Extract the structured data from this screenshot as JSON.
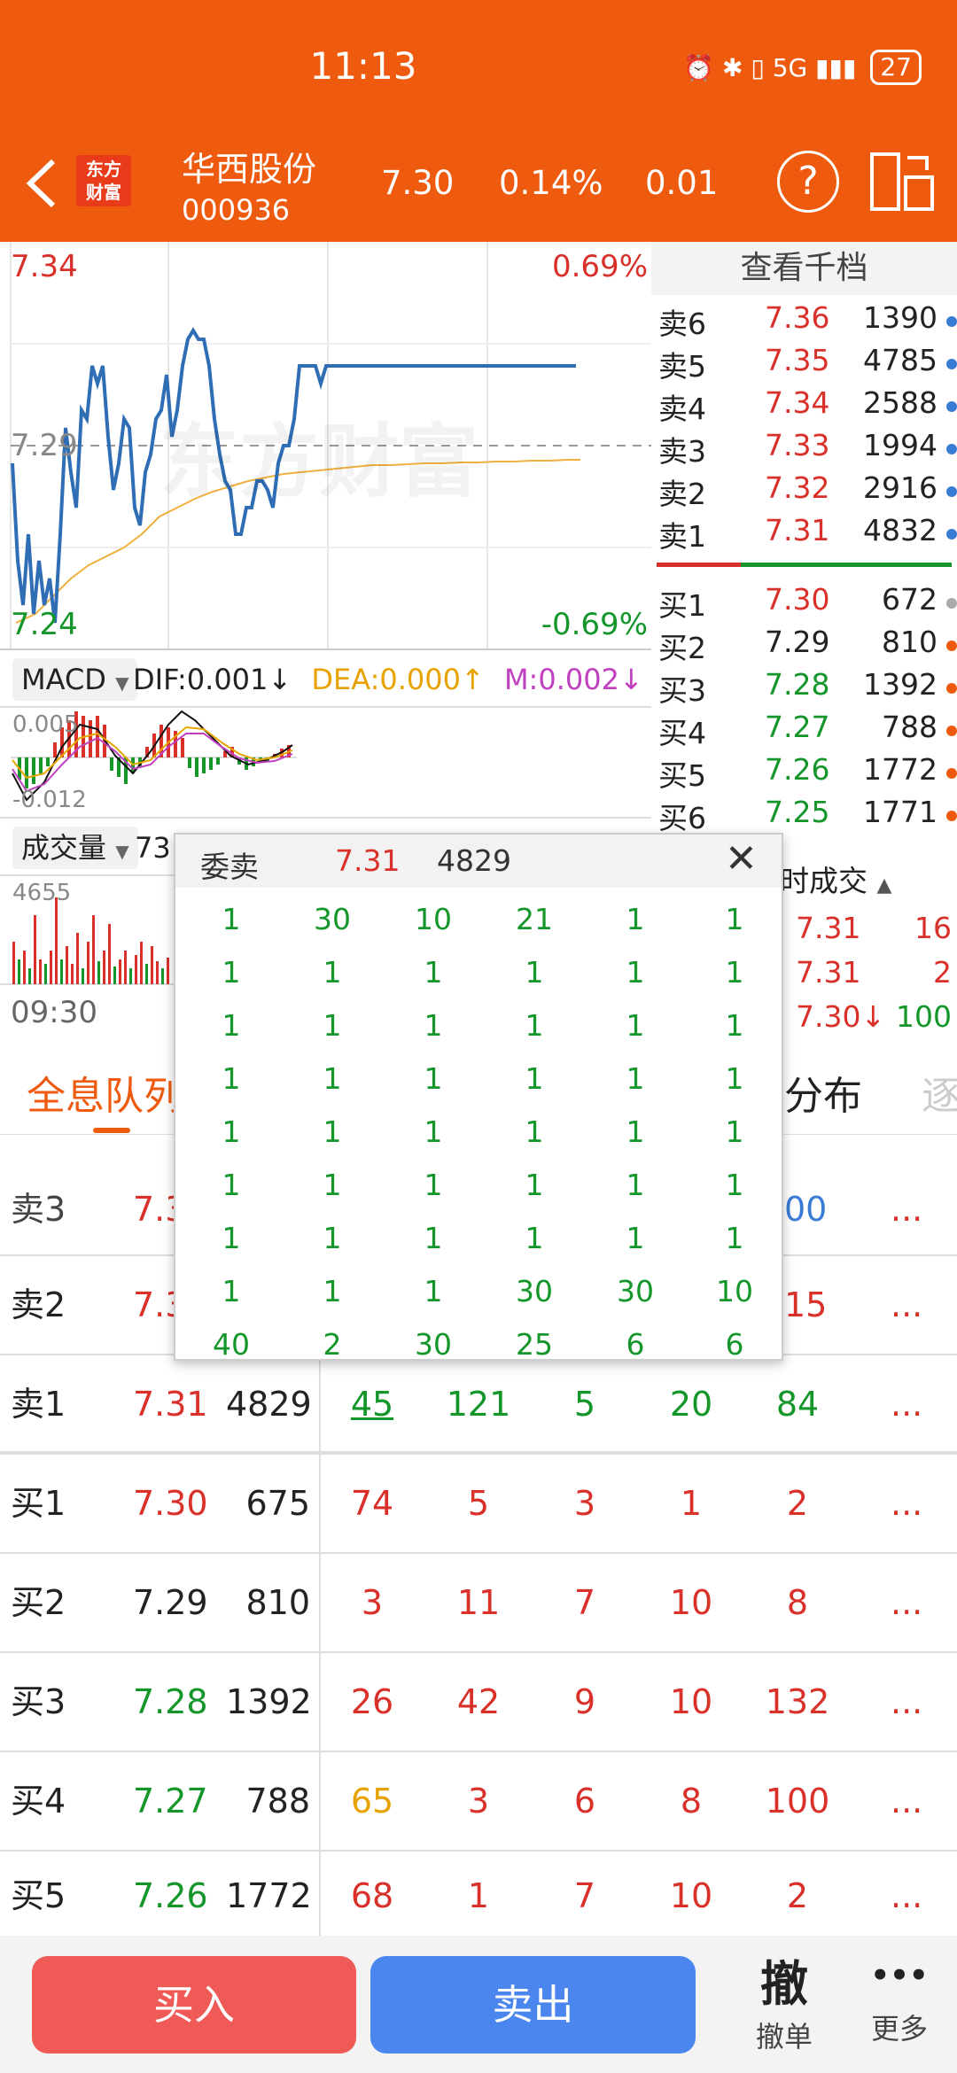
{
  "status_bar": {
    "time": "11:13",
    "icons": "⏰ ✱ ▯ 5G ▮▮▮",
    "battery": "27"
  },
  "header": {
    "logo": [
      "东方",
      "财富"
    ],
    "name": "华西股份",
    "code": "000936",
    "price": "7.30",
    "pct": "0.14%",
    "change": "0.01"
  },
  "chart": {
    "top_price": "7.34",
    "top_pct": "0.69%",
    "mid_price": "7.29",
    "bottom_price": "7.24",
    "bottom_pct": "-0.69%",
    "watermark": "东方财富",
    "macd_select": "MACD",
    "dif": "DIF:0.001",
    "dif_arrow": "↓",
    "dea": "DEA:0.000",
    "dea_arrow": "↑",
    "m": "M:0.002",
    "m_arrow": "↓",
    "macd_top": "0.005",
    "macd_bottom": "-0.012",
    "vol_select": "成交量",
    "vol_value": "73",
    "vol_max": "4655",
    "time_start": "09:30"
  },
  "depth": {
    "title": "查看千档",
    "asks": [
      {
        "label": "卖6",
        "price": "7.36",
        "vol": "1390"
      },
      {
        "label": "卖5",
        "price": "7.35",
        "vol": "4785"
      },
      {
        "label": "卖4",
        "price": "7.34",
        "vol": "2588"
      },
      {
        "label": "卖3",
        "price": "7.33",
        "vol": "1994"
      },
      {
        "label": "卖2",
        "price": "7.32",
        "vol": "2916"
      },
      {
        "label": "卖1",
        "price": "7.31",
        "vol": "4832"
      }
    ],
    "bids": [
      {
        "label": "买1",
        "price": "7.30",
        "vol": "672"
      },
      {
        "label": "买2",
        "price": "7.29",
        "vol": "810"
      },
      {
        "label": "买3",
        "price": "7.28",
        "vol": "1392"
      },
      {
        "label": "买4",
        "price": "7.27",
        "vol": "788"
      },
      {
        "label": "买5",
        "price": "7.26",
        "vol": "1772"
      },
      {
        "label": "买6",
        "price": "7.25",
        "vol": "1771"
      }
    ]
  },
  "trades": {
    "title": "时成交",
    "rows": [
      {
        "price": "7.31",
        "vol": "16"
      },
      {
        "price": "7.31",
        "vol": "2"
      },
      {
        "price": "7.30↓",
        "vol": "100"
      }
    ]
  },
  "tabs": {
    "active": "全息队列",
    "dist": "分布",
    "next": "逐"
  },
  "table": {
    "partial_top": {
      "name": "卖3",
      "price": "7.3",
      "tail": "00"
    },
    "partial_2": {
      "name": "卖2",
      "price": "7.3",
      "tail": "15"
    },
    "rows": [
      {
        "name": "卖1",
        "price": "7.31",
        "vol": "4829",
        "q": [
          "45",
          "121",
          "5",
          "20",
          "84"
        ]
      },
      {
        "name": "买1",
        "price": "7.30",
        "vol": "675",
        "q": [
          "74",
          "5",
          "3",
          "1",
          "2"
        ]
      },
      {
        "name": "买2",
        "price": "7.29",
        "vol": "810",
        "q": [
          "3",
          "11",
          "7",
          "10",
          "8"
        ]
      },
      {
        "name": "买3",
        "price": "7.28",
        "vol": "1392",
        "q": [
          "26",
          "42",
          "9",
          "10",
          "132"
        ]
      },
      {
        "name": "买4",
        "price": "7.27",
        "vol": "788",
        "q": [
          "65",
          "3",
          "6",
          "8",
          "100"
        ]
      },
      {
        "name": "买5",
        "price": "7.26",
        "vol": "1772",
        "q": [
          "68",
          "1",
          "7",
          "10",
          "2"
        ]
      }
    ],
    "more": "..."
  },
  "popup": {
    "title": "委卖",
    "price": "7.31",
    "vol": "4829",
    "close": "✕",
    "rows": [
      [
        "1",
        "30",
        "10",
        "21",
        "1",
        "1"
      ],
      [
        "1",
        "1",
        "1",
        "1",
        "1",
        "1"
      ],
      [
        "1",
        "1",
        "1",
        "1",
        "1",
        "1"
      ],
      [
        "1",
        "1",
        "1",
        "1",
        "1",
        "1"
      ],
      [
        "1",
        "1",
        "1",
        "1",
        "1",
        "1"
      ],
      [
        "1",
        "1",
        "1",
        "1",
        "1",
        "1"
      ],
      [
        "1",
        "1",
        "1",
        "1",
        "1",
        "1"
      ],
      [
        "1",
        "1",
        "1",
        "30",
        "30",
        "10"
      ],
      [
        "40",
        "2",
        "30",
        "25",
        "6",
        "6"
      ]
    ]
  },
  "bottom": {
    "buy": "买入",
    "sell": "卖出",
    "cancel_icon": "撤",
    "cancel": "撤单",
    "more_icon": "•••",
    "more": "更多"
  }
}
